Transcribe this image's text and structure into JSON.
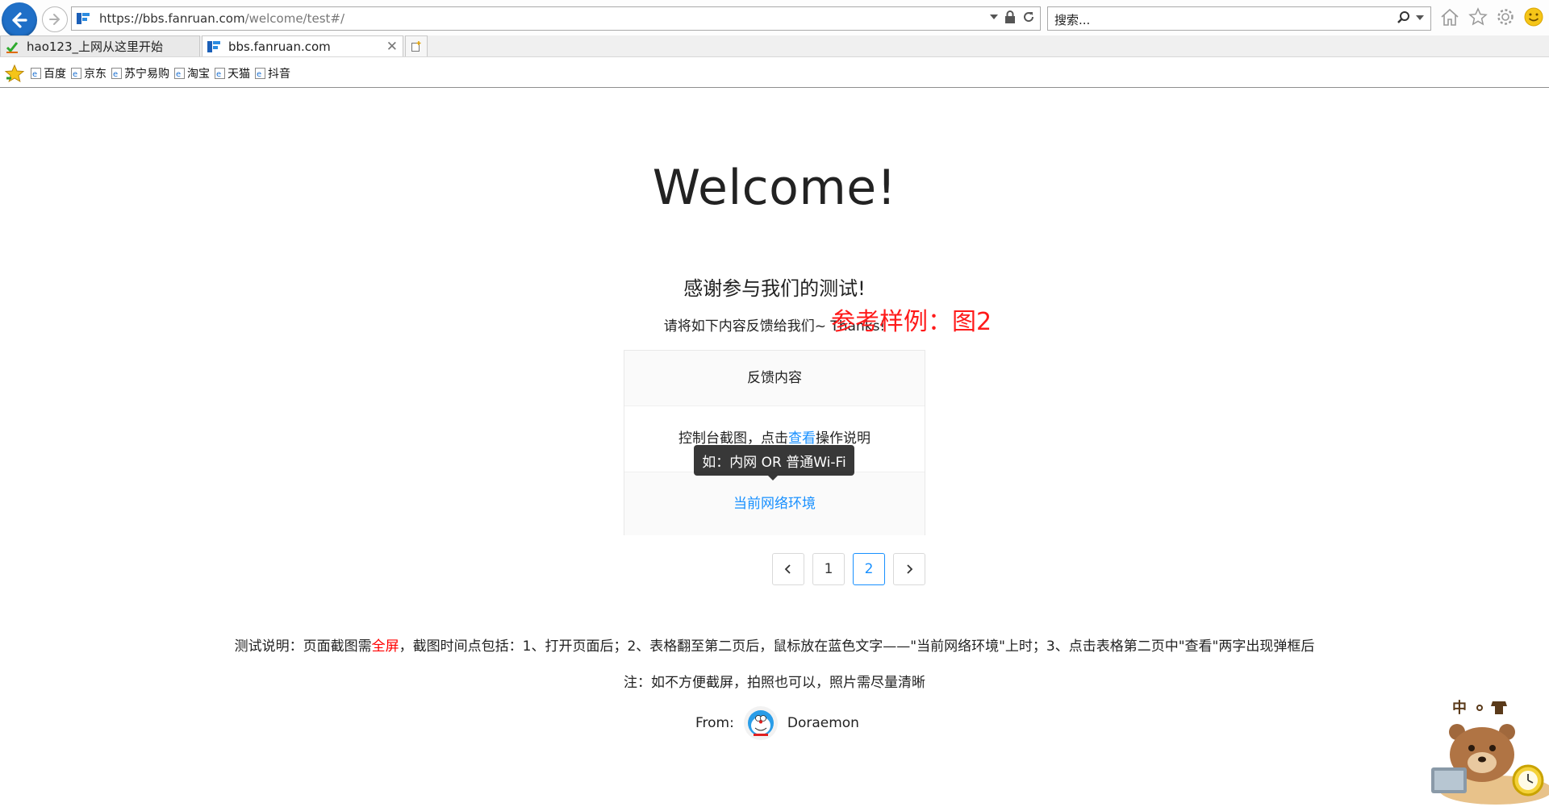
{
  "browser": {
    "url_host": "https://bbs.fanruan.com",
    "url_path": "/welcome/test#/",
    "search_placeholder": "搜索...",
    "tabs": [
      {
        "label": "hao123_上网从这里开始",
        "active": false
      },
      {
        "label": "bbs.fanruan.com",
        "active": true
      }
    ],
    "favorites": [
      "百度",
      "京东",
      "苏宁易购",
      "淘宝",
      "天猫",
      "抖音"
    ]
  },
  "page": {
    "title": "Welcome!",
    "thanks": "感谢参与我们的测试!",
    "feedback_request": "请将如下内容反馈给我们~ Thanks!",
    "sample_label": "参考样例：图2",
    "table": {
      "header": "反馈内容",
      "row1_prefix": "控制台截图，点击",
      "row1_link": "查看",
      "row1_suffix": "操作说明",
      "row2_link": "当前网络环境"
    },
    "tooltip": "如：内网 OR 普通Wi-Fi",
    "pagination": {
      "prev": "<",
      "pages": [
        "1",
        "2"
      ],
      "current": "2",
      "next": ">"
    },
    "note1_prefix": "测试说明：页面截图需",
    "note1_highlight": "全屏",
    "note1_suffix": "，截图时间点包括：1、打开页面后；2、表格翻至第二页后，鼠标放在蓝色文字——\"当前网络环境\"上时；3、点击表格第二页中\"查看\"两字出现弹框后",
    "note2": "注：如不方便截屏，拍照也可以，照片需尽量清晰",
    "from_label": "From:",
    "from_name": "Doraemon",
    "ime_label": "中"
  },
  "colors": {
    "accent": "#1890ff",
    "highlight": "#ff0000",
    "sample_label": "#ff1a1a"
  }
}
